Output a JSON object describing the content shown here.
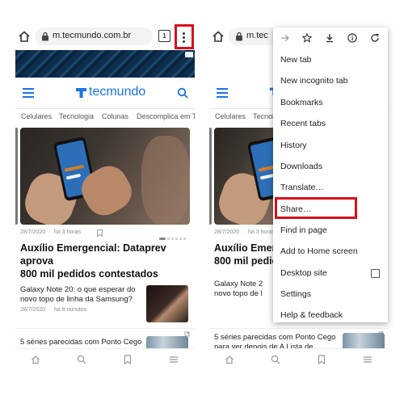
{
  "browser": {
    "url": "m.tecmundo.com.br",
    "tab_count": "1"
  },
  "site": {
    "logo_text": "tecmundo",
    "categories": [
      "Celulares",
      "Tecnologia",
      "Colunas",
      "Descomplica em Tec"
    ]
  },
  "hero": {
    "date": "28/7/2020",
    "age": "há 3 horas",
    "headline_line1": "Auxílio Emergencial: Dataprev aprova",
    "headline_line2": "800 mil pedidos contestados"
  },
  "stories": [
    {
      "title_line1": "Galaxy Note 20: o que esperar do",
      "title_line2": "novo topo de linha da Samsung?",
      "date": "28/7/2020",
      "age": "há 8 minutos"
    },
    {
      "title_line1": "5 séries parecidas com Ponto Cego",
      "title_line2": "para ver depois de A Lista de Blindspot"
    }
  ],
  "right_partial": {
    "url": "m.tec",
    "categories": [
      "Celulares",
      "Tecnol"
    ],
    "headline_line1": "Auxílio Emer",
    "headline_line2": "800 mil pedid",
    "story_line1": "Galaxy Note 2",
    "story_line2": "novo topo de l",
    "story2_line1": "5 séries parecidas com Ponto Cego",
    "story2_line2": "para ver depois de A Lista de Blindspot"
  },
  "menu": {
    "items": [
      "New tab",
      "New incognito tab",
      "Bookmarks",
      "Recent tabs",
      "History",
      "Downloads",
      "Translate…",
      "Share…",
      "Find in page",
      "Add to Home screen",
      "Desktop site",
      "Settings",
      "Help & feedback"
    ],
    "top_icons": [
      "forward-icon",
      "star-icon",
      "download-icon",
      "info-icon",
      "refresh-icon"
    ],
    "highlighted": "Share…"
  },
  "colors": {
    "brand": "#1a73e8",
    "highlight": "#d4111b"
  }
}
